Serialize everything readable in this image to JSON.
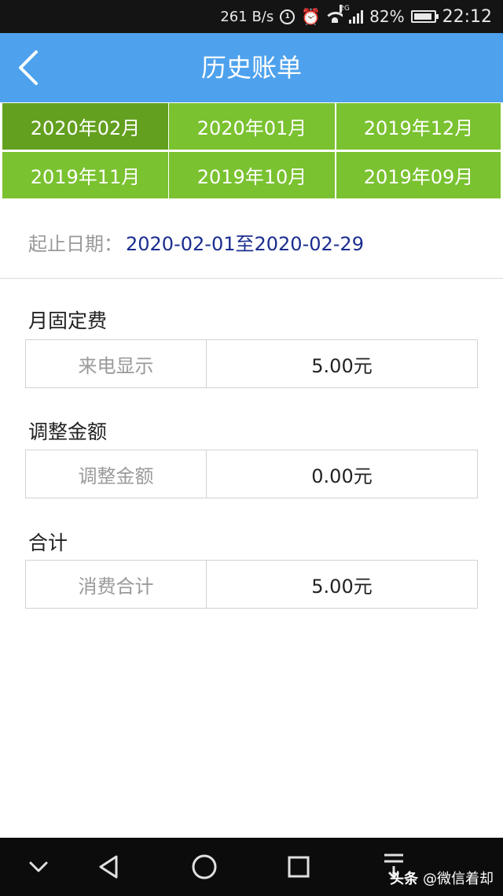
{
  "status_bar": {
    "speed": "261 B/s",
    "network_tag": "2G",
    "battery": "82%",
    "time": "22:12",
    "icons": [
      "data-saver-icon",
      "alarm-icon",
      "wifi-icon",
      "signal-icon",
      "battery-icon"
    ]
  },
  "header": {
    "title": "历史账单",
    "back_icon": "chevron-left-icon"
  },
  "months": [
    {
      "label": "2020年02月",
      "active": true
    },
    {
      "label": "2020年01月",
      "active": false
    },
    {
      "label": "2019年12月",
      "active": false
    },
    {
      "label": "2019年11月",
      "active": false
    },
    {
      "label": "2019年10月",
      "active": false
    },
    {
      "label": "2019年09月",
      "active": false
    }
  ],
  "date_range": {
    "label": "起止日期：",
    "start": "2020-02-01",
    "separator": "至",
    "end": "2020-02-29"
  },
  "sections": [
    {
      "title": "月固定费",
      "item": "来电显示",
      "value": "5.00元"
    },
    {
      "title": "调整金额",
      "item": "调整金额",
      "value": "0.00元"
    },
    {
      "title": "合计",
      "item": "消费合计",
      "value": "5.00元"
    }
  ],
  "nav": {
    "icons": [
      "chevron-down-icon",
      "back-triangle-icon",
      "home-circle-icon",
      "recents-square-icon",
      "notification-pull-icon"
    ]
  },
  "watermark": {
    "logo": "头条",
    "text": "@微信着却"
  },
  "colors": {
    "header": "#4ea2ed",
    "month_button": "#7ac230",
    "month_button_active": "#63a01f",
    "date_value": "#1a2d8f"
  }
}
